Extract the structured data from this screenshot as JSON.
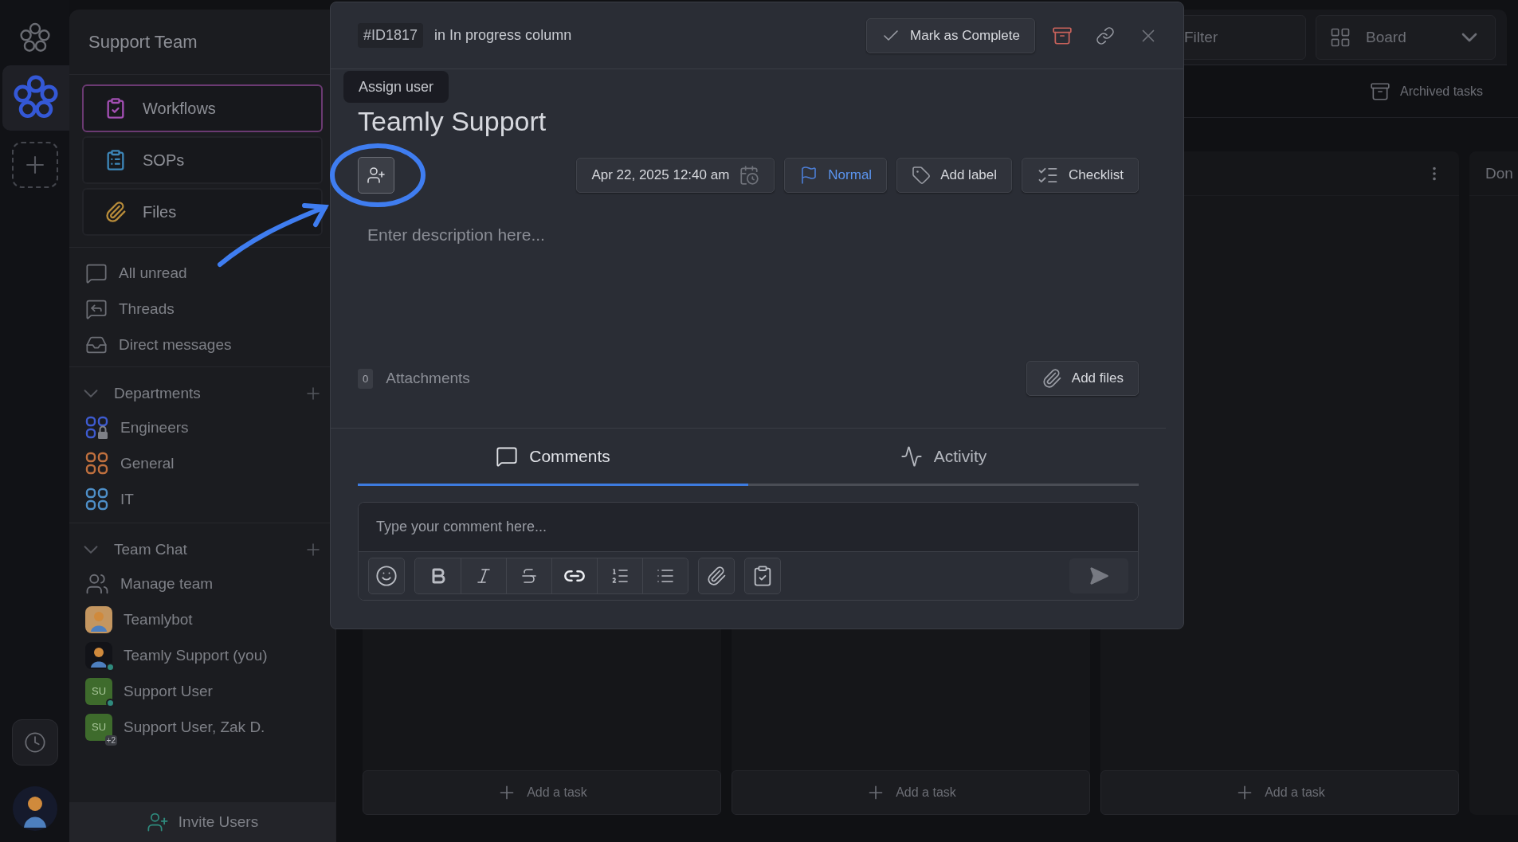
{
  "sidebar": {
    "title": "Support Team",
    "nav": [
      {
        "kind": "workflows",
        "label": "Workflows",
        "selected": true
      },
      {
        "kind": "sops",
        "label": "SOPs",
        "selected": false
      },
      {
        "kind": "files",
        "label": "Files",
        "selected": false
      }
    ],
    "links": [
      {
        "kind": "unread",
        "label": "All unread"
      },
      {
        "kind": "threads",
        "label": "Threads"
      },
      {
        "kind": "direct",
        "label": "Direct messages"
      }
    ],
    "departments": {
      "title": "Departments",
      "expanded": true,
      "items": [
        {
          "label": "Engineers",
          "color": "#3e5bd0",
          "locked": true
        },
        {
          "label": "General",
          "color": "#c0703e",
          "locked": false
        },
        {
          "label": "IT",
          "color": "#4e8fc8",
          "locked": false
        }
      ]
    },
    "team_chat": {
      "title": "Team Chat",
      "expanded": true,
      "items": [
        {
          "kind": "manage",
          "label": "Manage team"
        },
        {
          "kind": "avatar",
          "label": "Teamlybot",
          "online": false
        },
        {
          "kind": "avatar",
          "label": "Teamly Support (you)",
          "online": true
        },
        {
          "kind": "initials",
          "initials": "SU",
          "label": "Support User",
          "online": true
        },
        {
          "kind": "initials",
          "initials": "SU",
          "label": "Support User, Zak D.",
          "extra": "+2"
        }
      ]
    },
    "invite": "Invite Users"
  },
  "board": {
    "filter": "Filter",
    "view": "Board",
    "archived": "Archived tasks",
    "columns": [
      {
        "add": "Add a task"
      },
      {
        "add": "Add a task"
      },
      {
        "add": "Add a task",
        "menu": true
      },
      {
        "title": "Don"
      }
    ]
  },
  "modal": {
    "id": "#ID1817",
    "location": "in In progress column",
    "complete": "Mark as Complete",
    "title": "Teamly Support",
    "tooltip": "Assign user",
    "date": "Apr 22, 2025 12:40 am",
    "priority": "Normal",
    "label": "Add label",
    "checklist": "Checklist",
    "description": {
      "placeholder": "Enter description here..."
    },
    "attachments": {
      "count": "0",
      "label": "Attachments",
      "add": "Add files"
    },
    "tabs": [
      {
        "kind": "comments",
        "label": "Comments",
        "selected": true
      },
      {
        "kind": "activity",
        "label": "Activity",
        "selected": false
      }
    ],
    "comment": {
      "placeholder": "Type your comment here..."
    }
  }
}
